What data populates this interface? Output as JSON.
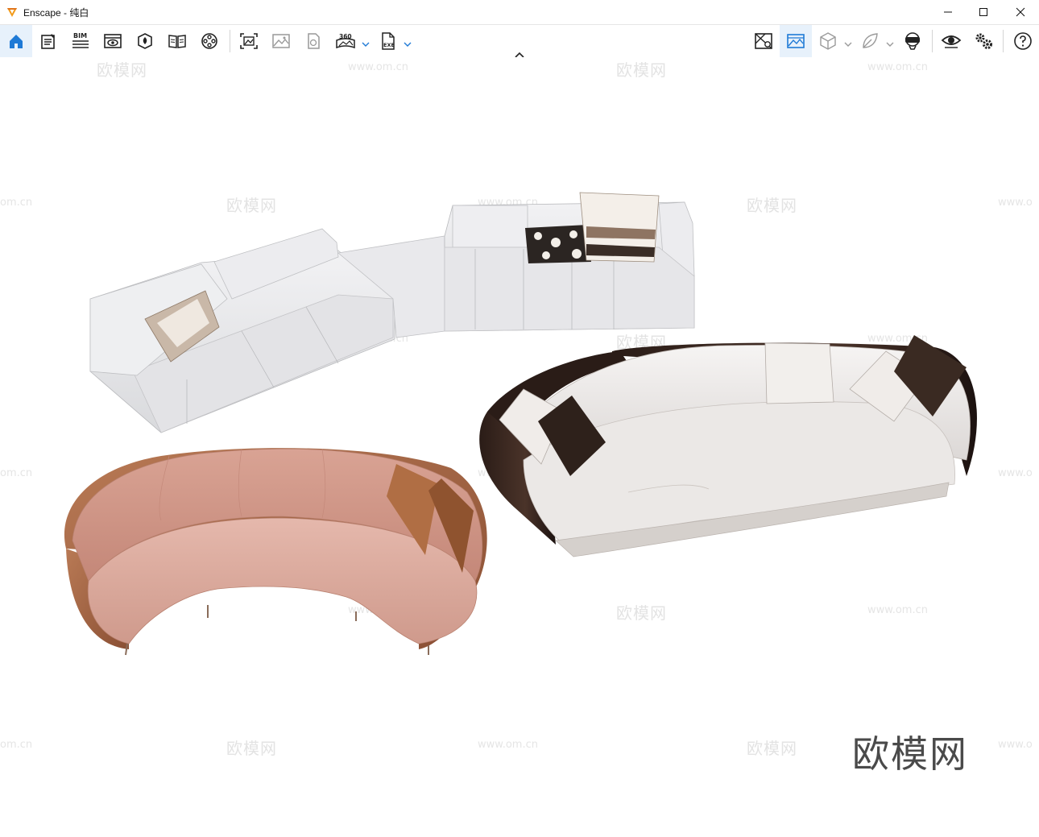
{
  "window": {
    "title": "Enscape - 纯白",
    "accent": "#1f7ad6",
    "controls": {
      "minimize": "minimize-icon",
      "maximize": "maximize-icon",
      "close": "close-icon"
    }
  },
  "toolbar": {
    "left_icons": [
      "home-icon",
      "notes-icon",
      "bim-icon",
      "views-icon",
      "asset-library-icon",
      "material-editor-icon",
      "video-editor-icon",
      "screenshot-icon",
      "batch-render-icon",
      "web-standalone-icon",
      "panorama-360-icon",
      "exe-export-icon"
    ],
    "bim_label": "BIM",
    "pano_label": "360",
    "exe_label": "EXE",
    "right_icons": [
      "sync-views-icon",
      "capture-view-icon",
      "orthographic-cube-icon",
      "material-leaf-icon",
      "vr-headset-icon",
      "eye-visual-settings-icon",
      "settings-gears-icon",
      "help-icon"
    ],
    "collapse": "chevron-up-icon"
  },
  "watermarks": {
    "text": "欧模网",
    "url": "www.om.cn",
    "url_partial": "om.cn",
    "url_cut": "www.o",
    "brand": "欧模网"
  },
  "scene": {
    "background": "#ffffff",
    "objects": [
      "white-modular-sectional-sofa",
      "white-curved-sofa-dark-frame",
      "pink-velvet-curved-sofa"
    ]
  }
}
